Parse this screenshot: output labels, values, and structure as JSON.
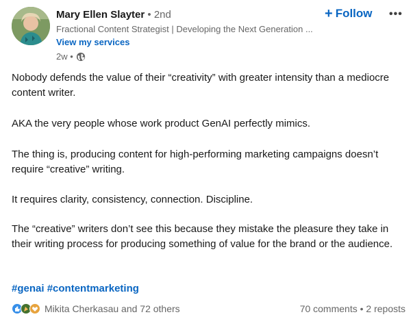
{
  "author": {
    "name": "Mary Ellen Slayter",
    "degree": "• 2nd",
    "headline": "Fractional Content Strategist | Developing the Next Generation ...",
    "services_link": "View my services",
    "time": "2w •"
  },
  "actions": {
    "follow_label": "Follow",
    "follow_icon": "+",
    "more_label": "•••"
  },
  "post": {
    "p1": "Nobody defends the value of their “creativity” with greater intensity than a mediocre content writer.",
    "p2": "AKA the very people whose work product GenAI perfectly mimics.",
    "p3": "The thing is, producing content for high-performing marketing campaigns doesn’t require “creative” writing.",
    "p4": "It requires clarity, consistency, connection. Discipline.",
    "p5": "The “creative” writers don’t see this because they mistake the pleasure they take in their writing process for producing something of value for the brand or the audience.",
    "hashtags": [
      "#genai",
      "#contentmarketing"
    ]
  },
  "social": {
    "reactors": "Mikita Cherkasau and 72 others",
    "counts": "70 comments • 2 reposts"
  },
  "colors": {
    "accent": "#0a66c2",
    "muted": "#666666",
    "text": "#191919"
  }
}
